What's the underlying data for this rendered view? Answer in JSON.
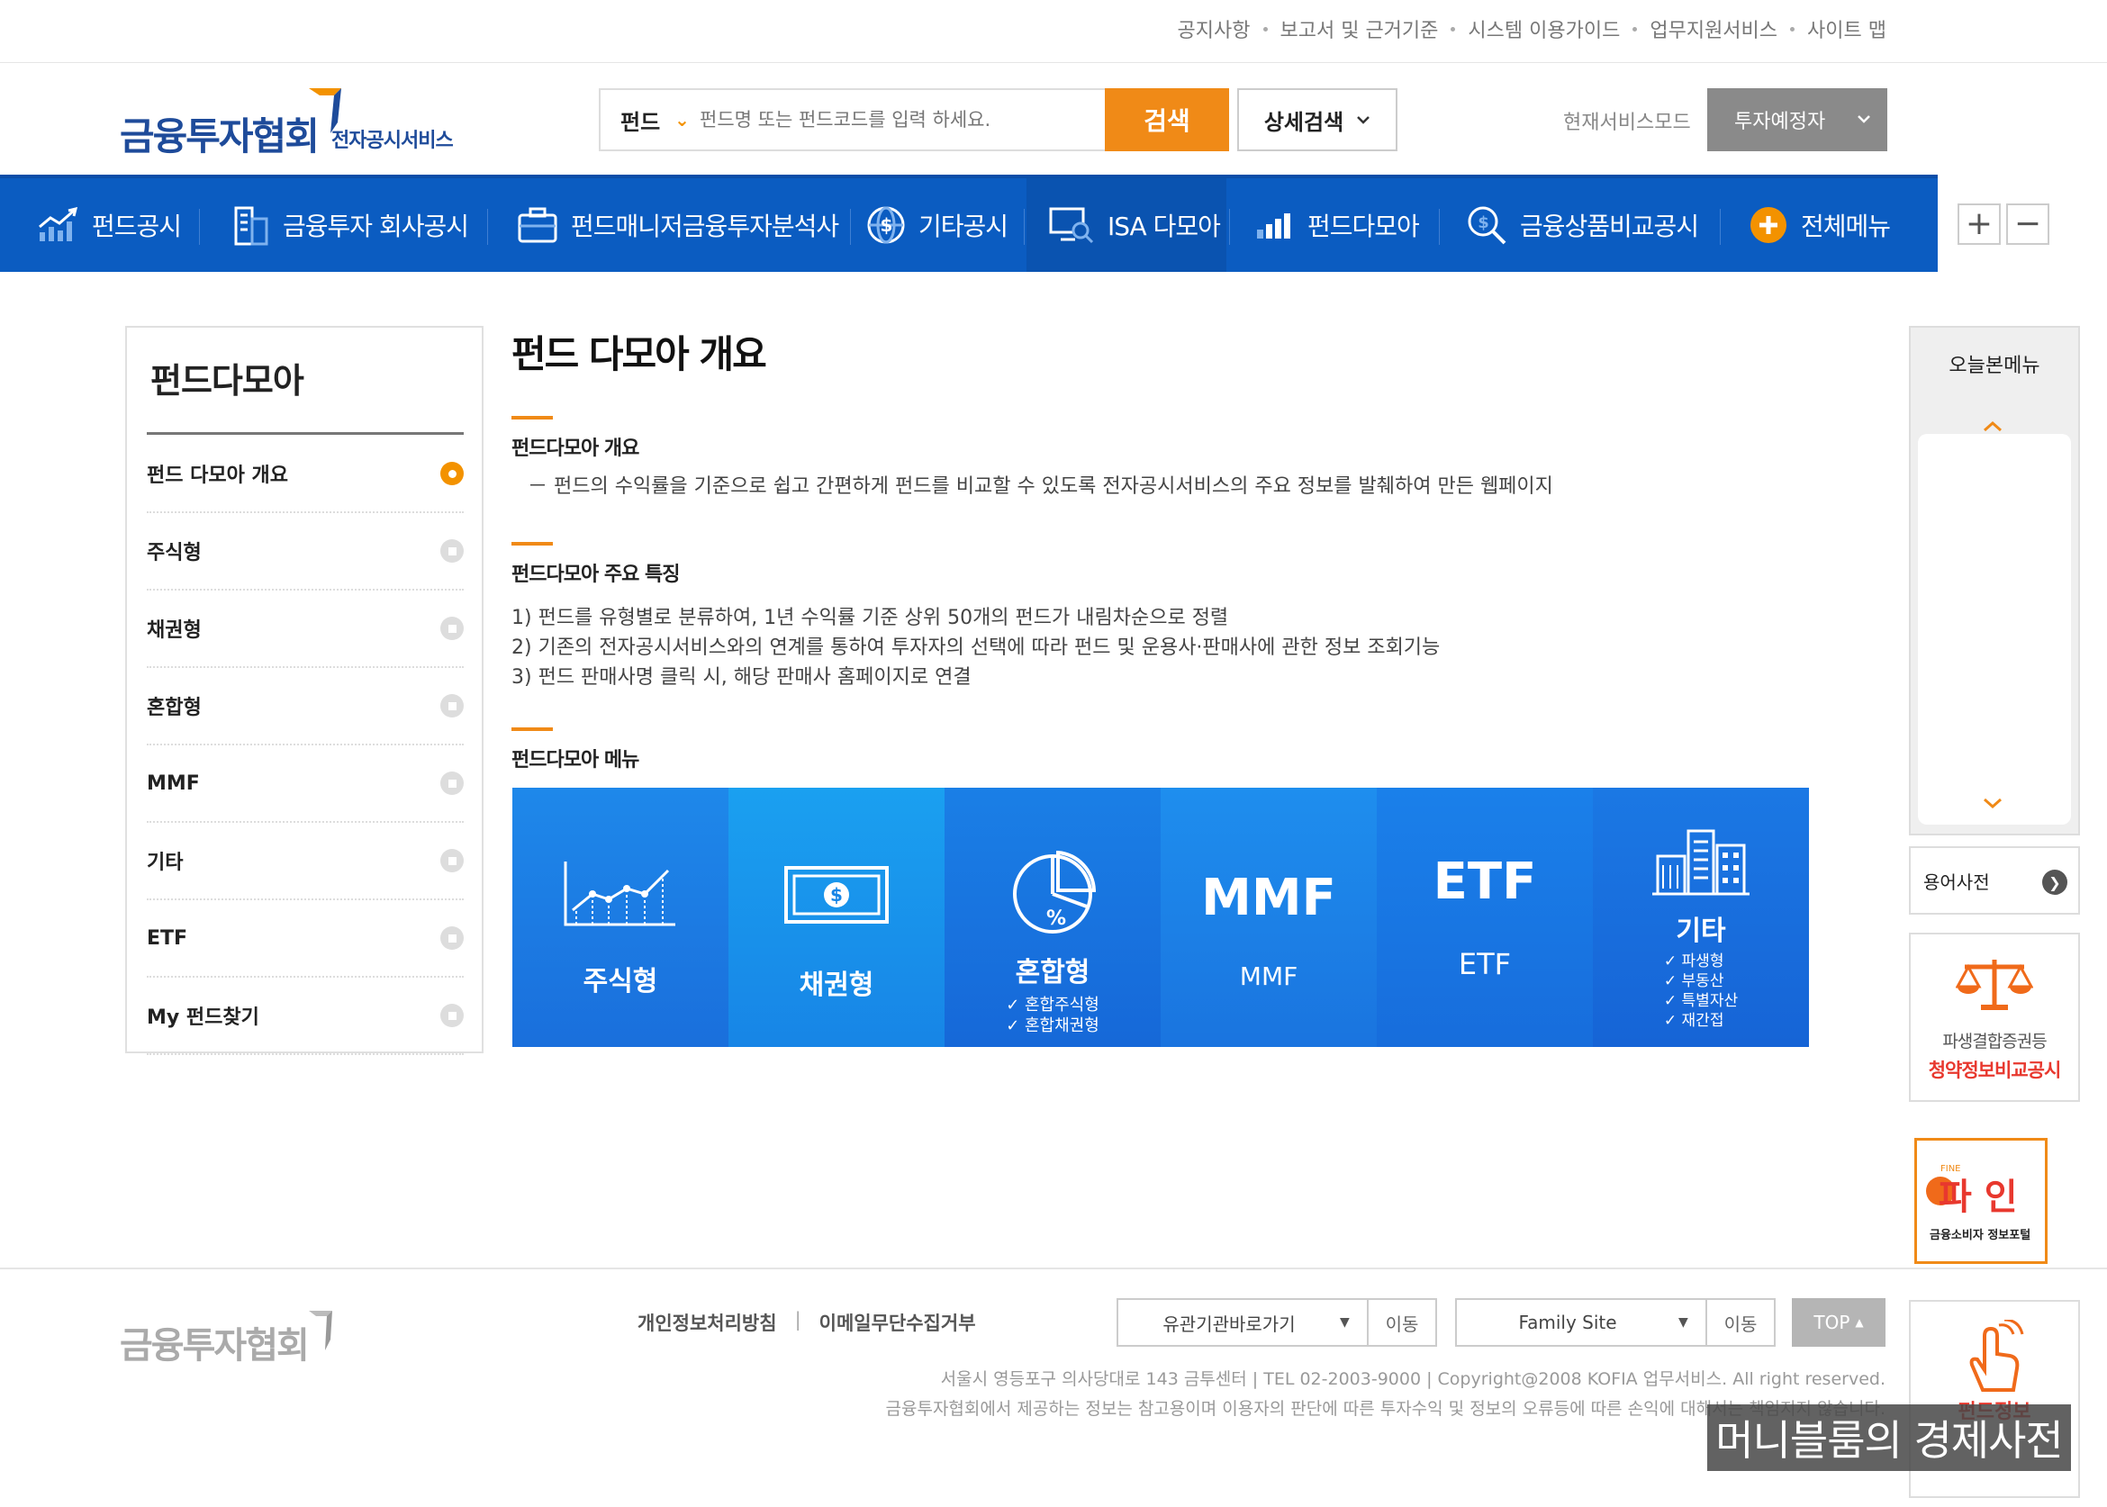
{
  "top_links": [
    "공지사항",
    "보고서 및 근거기준",
    "시스템 이용가이드",
    "업무지원서비스",
    "사이트 맵"
  ],
  "logo": {
    "main": "금융투자협회",
    "sub": "전자공시서비스"
  },
  "search": {
    "category": "펀드",
    "placeholder": "펀드명 또는 펀드코드를 입력 하세요.",
    "button": "검색"
  },
  "advanced_search": "상세검색",
  "service_mode": {
    "label": "현재서비스모드",
    "value": "투자예정자"
  },
  "nav": [
    "펀드공시",
    "금융투자 회사공시",
    "펀드매니저금융투자분석사",
    "기타공시",
    "ISA 다모아",
    "펀드다모아",
    "금융상품비교공시",
    "전체메뉴"
  ],
  "zoom": {
    "plus": "+",
    "minus": "−"
  },
  "sidebar": {
    "title": "펀드다모아",
    "items": [
      "펀드 다모아 개요",
      "주식형",
      "채권형",
      "혼합형",
      "MMF",
      "기타",
      "ETF",
      "My 펀드찾기"
    ]
  },
  "content": {
    "title": "펀드 다모아 개요",
    "sec1_title": "펀드다모아 개요",
    "sec1_text": "－ 펀드의 수익률을 기준으로 쉽고 간편하게 펀드를 비교할 수 있도록 전자공시서비스의 주요 정보를 발췌하여 만든 웹페이지",
    "sec2_title": "펀드다모아 주요 특징",
    "sec2_lines": [
      "1) 펀드를 유형별로 분류하여, 1년 수익률 기준 상위 50개의 펀드가 내림차순으로 정렬",
      "2) 기존의 전자공시서비스와의 연계를 통하여 투자자의 선택에 따라 펀드 및 운용사·판매사에 관한 정보 조회기능",
      "3) 펀드 판매사명 클릭 시, 해당 판매사 홈페이지로 연결"
    ],
    "sec3_title": "펀드다모아 메뉴"
  },
  "tiles": {
    "stock": {
      "label": "주식형"
    },
    "bond": {
      "label": "채권형"
    },
    "mixed": {
      "label": "혼합형",
      "subs": [
        "혼합주식형",
        "혼합채권형"
      ]
    },
    "mmf": {
      "big": "MMF",
      "label": "MMF"
    },
    "etf": {
      "big": "ETF",
      "label": "ETF"
    },
    "etc": {
      "label": "기타",
      "subs": [
        "파생형",
        "부동산",
        "특별자산",
        "재간접"
      ]
    }
  },
  "right": {
    "today": "오늘본메뉴",
    "dict": "용어사전",
    "banner1_line1": "파생결합증권등",
    "banner1_line2": "청약정보비교공시",
    "banner2_tag": "FINE",
    "banner2_main": "파 인",
    "banner2_sub": "금융소비자 정보포털",
    "banner3_text": "펀드정보"
  },
  "footer": {
    "logo": "금융투자협회",
    "links": [
      "개인정보처리방침",
      "이메일무단수집거부"
    ],
    "sep": "|",
    "select1": "유관기관바로가기",
    "select2": "Family Site",
    "go": "이동",
    "top": "TOP",
    "addr1": "서울시 영등포구 의사당대로 143 금투센터 | TEL 02-2003-9000 | Copyright@2008 KOFIA 업무서비스. All right reserved.",
    "addr2": "금융투자협회에서 제공하는 정보는 참고용이며 이용자의 판단에 따른 투자수익 및 정보의 오류등에 따른 손익에 대해서는 책임지지 않습니다."
  },
  "watermark": "머니블룸의 경제사전",
  "colors": {
    "nav": "#0b5cc1",
    "accent": "#f08a17",
    "logo": "#1e4b9a"
  }
}
